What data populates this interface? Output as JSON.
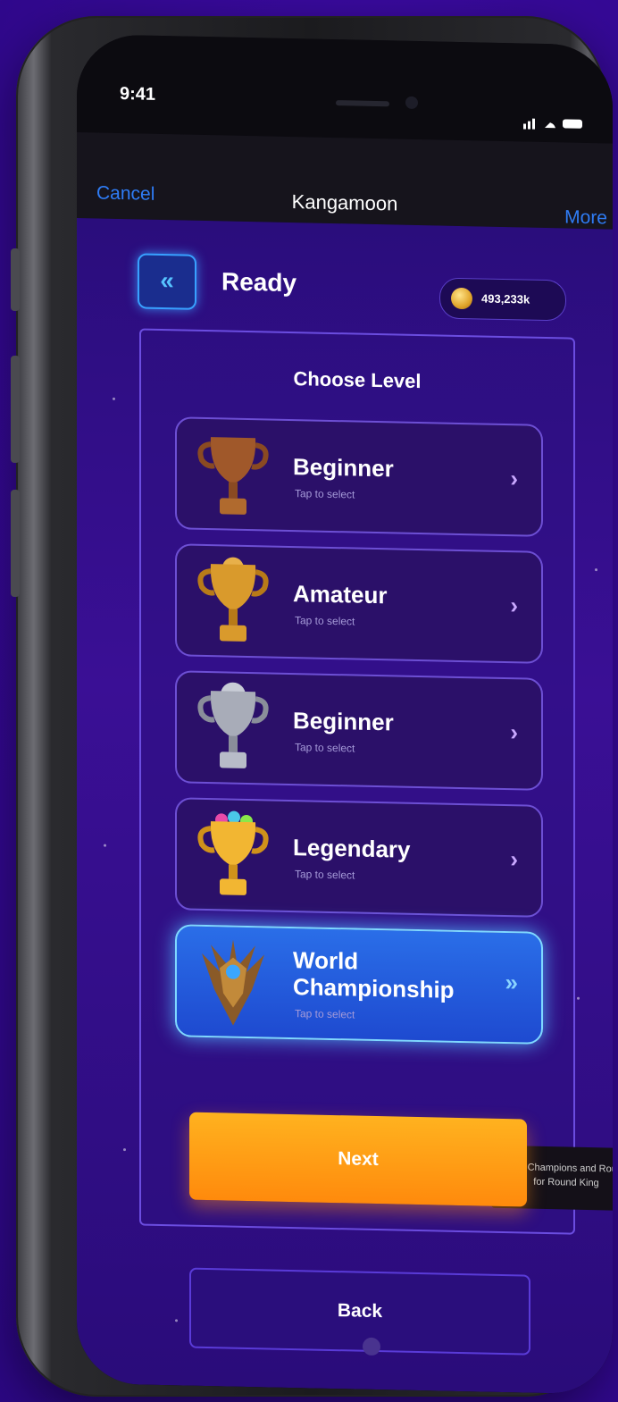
{
  "status_bar": {
    "time": "9:41",
    "icons": "…ᴄ ≡"
  },
  "nav": {
    "cancel": "Cancel",
    "title": "Kangamoon",
    "more": "More"
  },
  "header": {
    "back_icon": "«",
    "title": "Ready",
    "coins": "493,233k"
  },
  "panel": {
    "title": "Choose Level"
  },
  "levels": [
    {
      "name": "Beginner",
      "subtitle": "Tap to select",
      "icon": "bronze-trophy-icon",
      "color": "#b06a2e"
    },
    {
      "name": "Amateur",
      "subtitle": "Tap to select",
      "icon": "gold-trophy-icon",
      "color": "#d99a2c"
    },
    {
      "name": "Beginner",
      "subtitle": "Tap to select",
      "icon": "silver-trophy-icon",
      "color": "#b8bcc8"
    },
    {
      "name": "Legendary",
      "subtitle": "Tap to select",
      "icon": "jeweled-trophy-icon",
      "color": "#f2b632"
    },
    {
      "name": "World Championship",
      "subtitle": "Tap to select",
      "icon": "championship-emblem-icon",
      "color": "#8a5a28"
    }
  ],
  "tooltip": "Only Champions and Round for Round King",
  "buttons": {
    "next": "Next",
    "back": "Back"
  },
  "colors": {
    "accent": "#2f7cf5",
    "primary_button": "#ff9a12",
    "selected_card": "#2a6ee8"
  }
}
